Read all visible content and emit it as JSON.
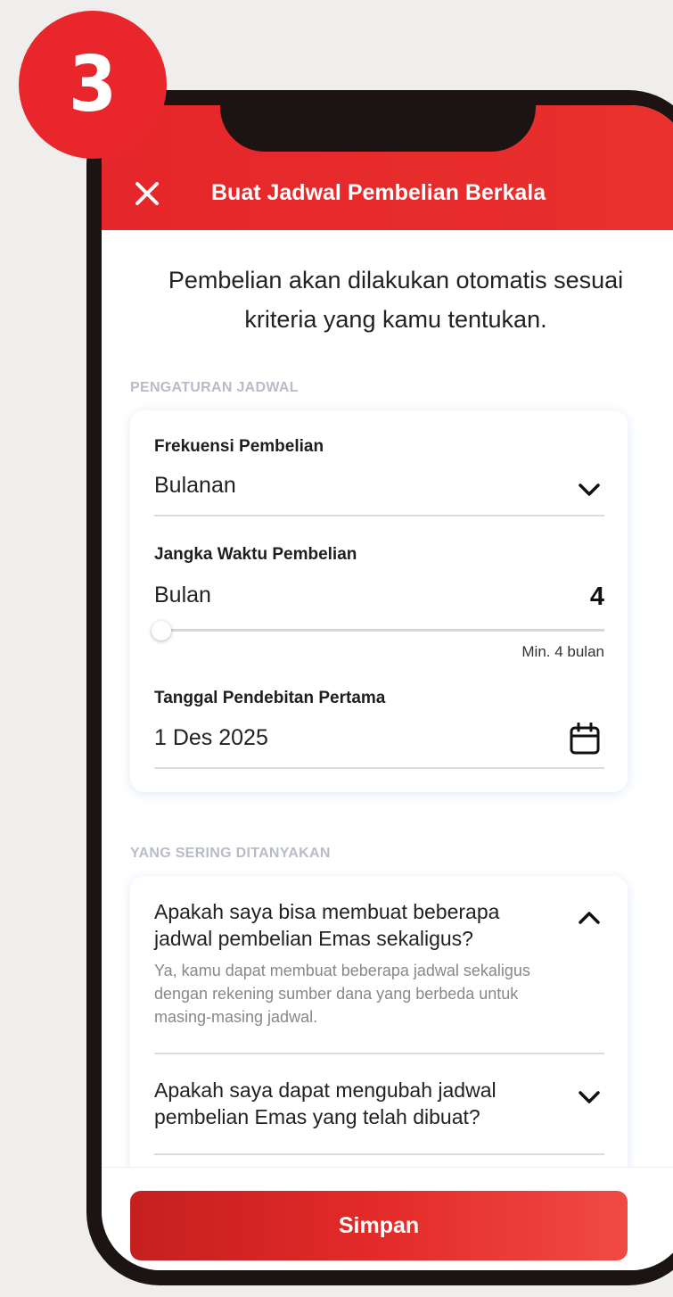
{
  "step_badge": "3",
  "header": {
    "title": "Buat Jadwal Pembelian Berkala",
    "close_icon": "close-icon"
  },
  "intro_text": "Pembelian akan dilakukan otomatis sesuai kriteria yang kamu tentukan.",
  "schedule_section": {
    "label": "PENGATURAN JADWAL",
    "frequency": {
      "label": "Frekuensi Pembelian",
      "value": "Bulanan",
      "icon": "chevron-down-icon"
    },
    "duration": {
      "label": "Jangka Waktu Pembelian",
      "unit": "Bulan",
      "value": "4",
      "min_text": "Min. 4 bulan",
      "slider_level": 0
    },
    "first_debit": {
      "label": "Tanggal Pendebitan Pertama",
      "value": "1 Des 2025",
      "icon": "calendar-icon"
    }
  },
  "faq_section": {
    "label": "YANG SERING DITANYAKAN",
    "items": [
      {
        "question": "Apakah saya bisa membuat beberapa jadwal pembelian Emas sekaligus?",
        "answer": "Ya, kamu dapat membuat beberapa jadwal sekaligus dengan rekening sumber dana yang berbeda untuk masing-masing jadwal.",
        "expanded": true,
        "icon": "chevron-up-icon"
      },
      {
        "question": "Apakah saya dapat mengubah jadwal pembelian Emas yang telah dibuat?",
        "expanded": false,
        "icon": "chevron-down-icon"
      }
    ]
  },
  "save_button": "Simpan",
  "colors": {
    "brand_red": "#e5262a",
    "phone_frame": "#1c1412",
    "section_label": "#b8bcc7"
  }
}
